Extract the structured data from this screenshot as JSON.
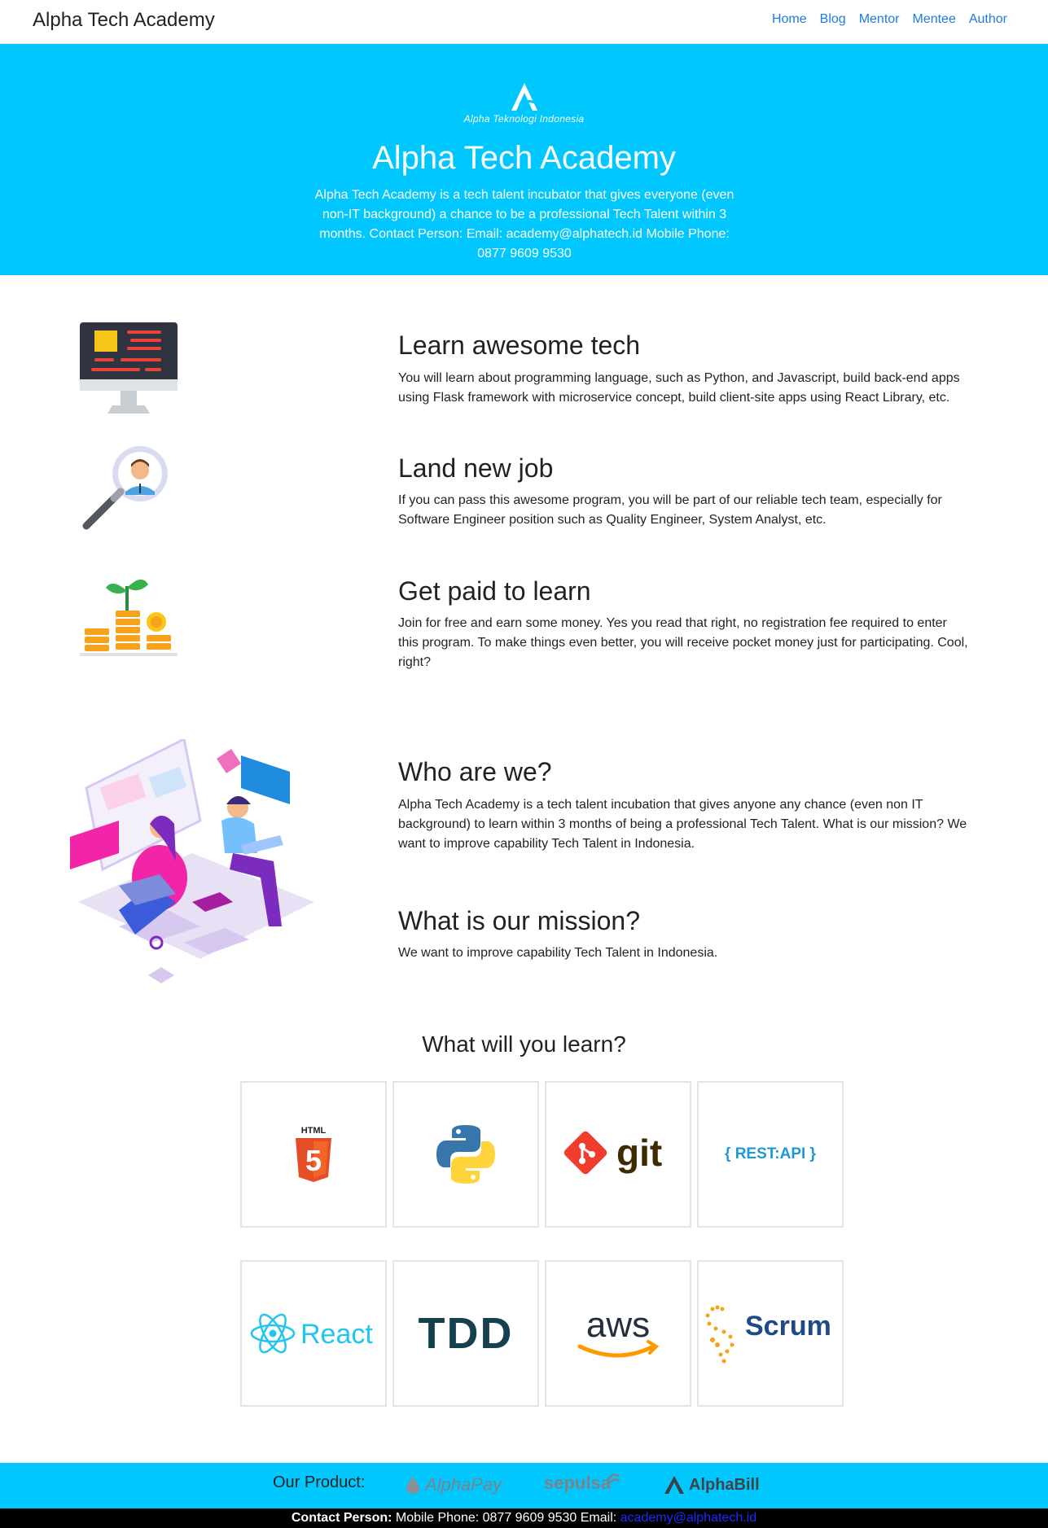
{
  "nav": {
    "brand": "Alpha Tech Academy",
    "links": [
      "Home",
      "Blog",
      "Mentor",
      "Mentee",
      "Author"
    ]
  },
  "hero": {
    "logo_caption": "Alpha Teknologi Indonesia",
    "title": "Alpha Tech Academy",
    "description": "Alpha Tech Academy is a tech talent incubator that gives everyone (even non-IT background) a chance to be a professional Tech Talent within 3 months. Contact Person: Email: academy@alphatech.id Mobile Phone: 0877 9609 9530"
  },
  "features": [
    {
      "icon": "monitor-icon",
      "title": "Learn awesome tech",
      "text": "You will learn about programming language, such as Python, and Javascript, build back-end apps using Flask framework with microservice concept, build client-site apps using React Library, etc."
    },
    {
      "icon": "magnifier-person-icon",
      "title": "Land new job",
      "text": "If you can pass this awesome program, you will be part of our reliable tech team, especially for Software Engineer position such as Quality Engineer, System Analyst, etc."
    },
    {
      "icon": "coins-plant-icon",
      "title": "Get paid to learn",
      "text": "Join for free and earn some money. Yes you read that right, no registration fee required to enter this program. To make things even better, you will receive pocket money just for participating. Cool, right?"
    }
  ],
  "about": {
    "who_title": "Who are we?",
    "who_text": "Alpha Tech Academy is a tech talent incubation that gives anyone any chance (even non IT background) to learn within 3 months of being a professional Tech Talent. What is our mission? We want to improve capability Tech Talent in Indonesia.",
    "mission_title": "What is our mission?",
    "mission_text": "We want to improve capability Tech Talent in Indonesia."
  },
  "learn": {
    "title": "What will you learn?",
    "tech": [
      {
        "name": "html5-logo",
        "label": "HTML",
        "glyph": "5"
      },
      {
        "name": "python-logo"
      },
      {
        "name": "git-logo",
        "label": "git"
      },
      {
        "name": "rest-api-logo",
        "label": "{ REST:API }"
      },
      {
        "name": "react-logo",
        "label": "React"
      },
      {
        "name": "tdd-logo",
        "label": "TDD"
      },
      {
        "name": "aws-logo",
        "label": "aws"
      },
      {
        "name": "scrum-logo",
        "label": "Scrum"
      }
    ]
  },
  "footer": {
    "products_label": "Our Product:",
    "products": [
      "AlphaPay",
      "sepulsa",
      "AlphaBill"
    ],
    "contact_label": "Contact Person:",
    "contact_text": " Mobile Phone: 0877 9609 9530 Email: ",
    "contact_email": "academy@alphatech.id"
  },
  "colors": {
    "hero_bg": "#00c8ff",
    "link": "#1e7be3",
    "bottom_bar": "#000000"
  }
}
